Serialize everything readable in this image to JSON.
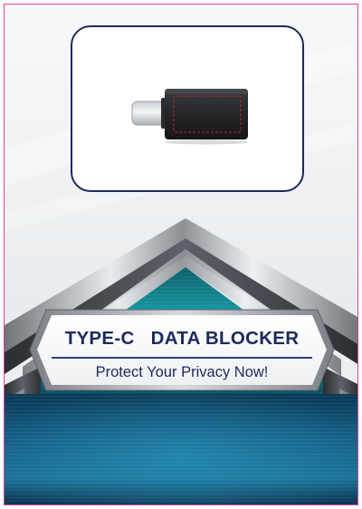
{
  "banner": {
    "title": "TYPE-C   DATA BLOCKER",
    "subtitle": "Protect Your Privacy Now!"
  },
  "colors": {
    "card_border": "#e23fa0",
    "frame_border": "#1c2a5c",
    "text_navy": "#1c2a5c",
    "teal_accent": "#1aa7b3",
    "adapter_stitch": "#c8232e"
  },
  "icons": [
    "usb-c-data-blocker-adapter-icon"
  ]
}
